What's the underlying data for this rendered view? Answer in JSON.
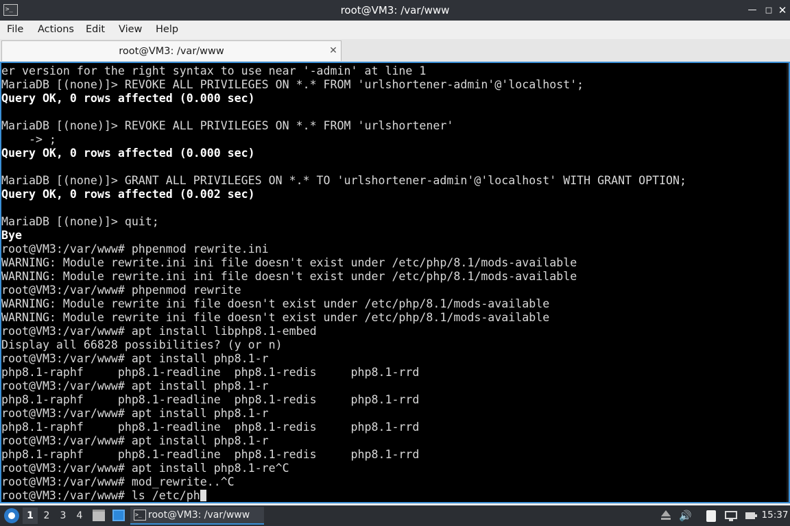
{
  "window": {
    "title": "root@VM3: /var/www",
    "minimize_glyph": "—",
    "maximize_glyph": "□",
    "close_glyph": "✕",
    "app_icon_glyph": ">_"
  },
  "menubar": {
    "items": [
      "File",
      "Actions",
      "Edit",
      "View",
      "Help"
    ]
  },
  "tabs": [
    {
      "label": "root@VM3: /var/www",
      "close_glyph": "✕",
      "active": true
    }
  ],
  "terminal": {
    "lines": [
      {
        "text": "er version for the right syntax to use near '-admin' at line 1",
        "bold": false
      },
      {
        "text": "MariaDB [(none)]> REVOKE ALL PRIVILEGES ON *.* FROM 'urlshortener-admin'@'localhost';",
        "bold": false
      },
      {
        "text": "Query OK, 0 rows affected (0.000 sec)",
        "bold": true
      },
      {
        "text": "",
        "bold": false
      },
      {
        "text": "MariaDB [(none)]> REVOKE ALL PRIVILEGES ON *.* FROM 'urlshortener'",
        "bold": false
      },
      {
        "text": "    -> ;",
        "bold": false
      },
      {
        "text": "Query OK, 0 rows affected (0.000 sec)",
        "bold": true
      },
      {
        "text": "",
        "bold": false
      },
      {
        "text": "MariaDB [(none)]> GRANT ALL PRIVILEGES ON *.* TO 'urlshortener-admin'@'localhost' WITH GRANT OPTION;",
        "bold": false
      },
      {
        "text": "Query OK, 0 rows affected (0.002 sec)",
        "bold": true
      },
      {
        "text": "",
        "bold": false
      },
      {
        "text": "MariaDB [(none)]> quit;",
        "bold": false
      },
      {
        "text": "Bye",
        "bold": true
      },
      {
        "text": "root@VM3:/var/www# phpenmod rewrite.ini",
        "bold": false
      },
      {
        "text": "WARNING: Module rewrite.ini ini file doesn't exist under /etc/php/8.1/mods-available",
        "bold": false
      },
      {
        "text": "WARNING: Module rewrite.ini ini file doesn't exist under /etc/php/8.1/mods-available",
        "bold": false
      },
      {
        "text": "root@VM3:/var/www# phpenmod rewrite",
        "bold": false
      },
      {
        "text": "WARNING: Module rewrite ini file doesn't exist under /etc/php/8.1/mods-available",
        "bold": false
      },
      {
        "text": "WARNING: Module rewrite ini file doesn't exist under /etc/php/8.1/mods-available",
        "bold": false
      },
      {
        "text": "root@VM3:/var/www# apt install libphp8.1-embed",
        "bold": false
      },
      {
        "text": "Display all 66828 possibilities? (y or n)",
        "bold": false
      },
      {
        "text": "root@VM3:/var/www# apt install php8.1-r",
        "bold": false
      },
      {
        "text": "php8.1-raphf     php8.1-readline  php8.1-redis     php8.1-rrd",
        "bold": false
      },
      {
        "text": "root@VM3:/var/www# apt install php8.1-r",
        "bold": false
      },
      {
        "text": "php8.1-raphf     php8.1-readline  php8.1-redis     php8.1-rrd",
        "bold": false
      },
      {
        "text": "root@VM3:/var/www# apt install php8.1-r",
        "bold": false
      },
      {
        "text": "php8.1-raphf     php8.1-readline  php8.1-redis     php8.1-rrd",
        "bold": false
      },
      {
        "text": "root@VM3:/var/www# apt install php8.1-r",
        "bold": false
      },
      {
        "text": "php8.1-raphf     php8.1-readline  php8.1-redis     php8.1-rrd",
        "bold": false
      },
      {
        "text": "root@VM3:/var/www# apt install php8.1-re^C",
        "bold": false
      },
      {
        "text": "root@VM3:/var/www# mod_rewrite..^C",
        "bold": false
      },
      {
        "text": "root@VM3:/var/www# ls /etc/ph",
        "bold": false,
        "cursor": true
      }
    ]
  },
  "taskbar": {
    "workspaces": [
      {
        "label": "1",
        "active": true
      },
      {
        "label": "2",
        "active": false
      },
      {
        "label": "3",
        "active": false
      },
      {
        "label": "4",
        "active": false
      }
    ],
    "task": {
      "label": "root@VM3: /var/www",
      "icon_glyph": ">_"
    },
    "tray": {
      "volume_glyph": "🔊",
      "icons": [
        "eject-icon",
        "volume-icon",
        "clipboard-icon",
        "network-icon",
        "power-icon"
      ]
    },
    "clock": "15:37"
  },
  "colors": {
    "titlebar": "#2f3238",
    "terminal_bg": "#000000",
    "terminal_fg": "#d8d8d8",
    "focus_border": "#3a8fd6",
    "taskbar": "#2b2e33"
  }
}
